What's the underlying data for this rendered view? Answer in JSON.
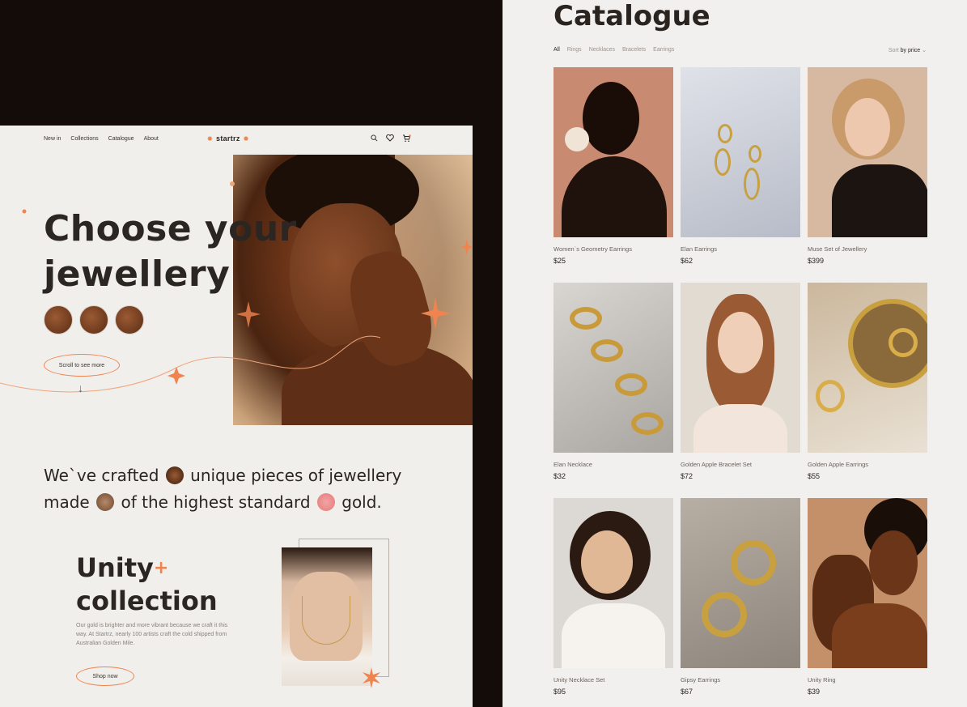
{
  "landing": {
    "nav": {
      "links": [
        "New in",
        "Collections",
        "Catalogue",
        "About"
      ],
      "logo": "startrz"
    },
    "hero": {
      "title_line1": "Choose your",
      "title_line2": "jewellery",
      "scroll_label": "Scroll to see more",
      "arrow": "↓"
    },
    "crafted": {
      "part1": "We`ve crafted",
      "part2": "unique pieces of jewellery",
      "part3": "made",
      "part4": "of the highest standard",
      "part5": "gold."
    },
    "unity": {
      "title_line1": "Unity",
      "title_line2": "collection",
      "description": "Our gold is brighter and more vibrant because we craft it this way. At Startrz, nearly 100 artists craft the cold shipped from Australian Golden Mile.",
      "shop_label": "Shop now"
    }
  },
  "catalogue": {
    "title": "Catalogue",
    "filters": [
      "All",
      "Rings",
      "Necklaces",
      "Bracelets",
      "Earrings"
    ],
    "sort_prefix": "Sort",
    "sort_value": "by price",
    "products": [
      {
        "name": "Women`s Geometry Earrings",
        "price": "$25"
      },
      {
        "name": "Elan Earrings",
        "price": "$62"
      },
      {
        "name": "Muse Set of Jewellery",
        "price": "$399"
      },
      {
        "name": "Elan Necklace",
        "price": "$32"
      },
      {
        "name": "Golden Apple Bracelet Set",
        "price": "$72"
      },
      {
        "name": "Golden Apple Earrings",
        "price": "$55"
      },
      {
        "name": "Unity Necklace Set",
        "price": "$95"
      },
      {
        "name": "Gipsy Earrings",
        "price": "$67"
      },
      {
        "name": "Unity Ring",
        "price": "$39"
      }
    ]
  },
  "colors": {
    "accent": "#f0844f",
    "page_bg": "#140c08",
    "panel_bg": "#f1efec"
  }
}
